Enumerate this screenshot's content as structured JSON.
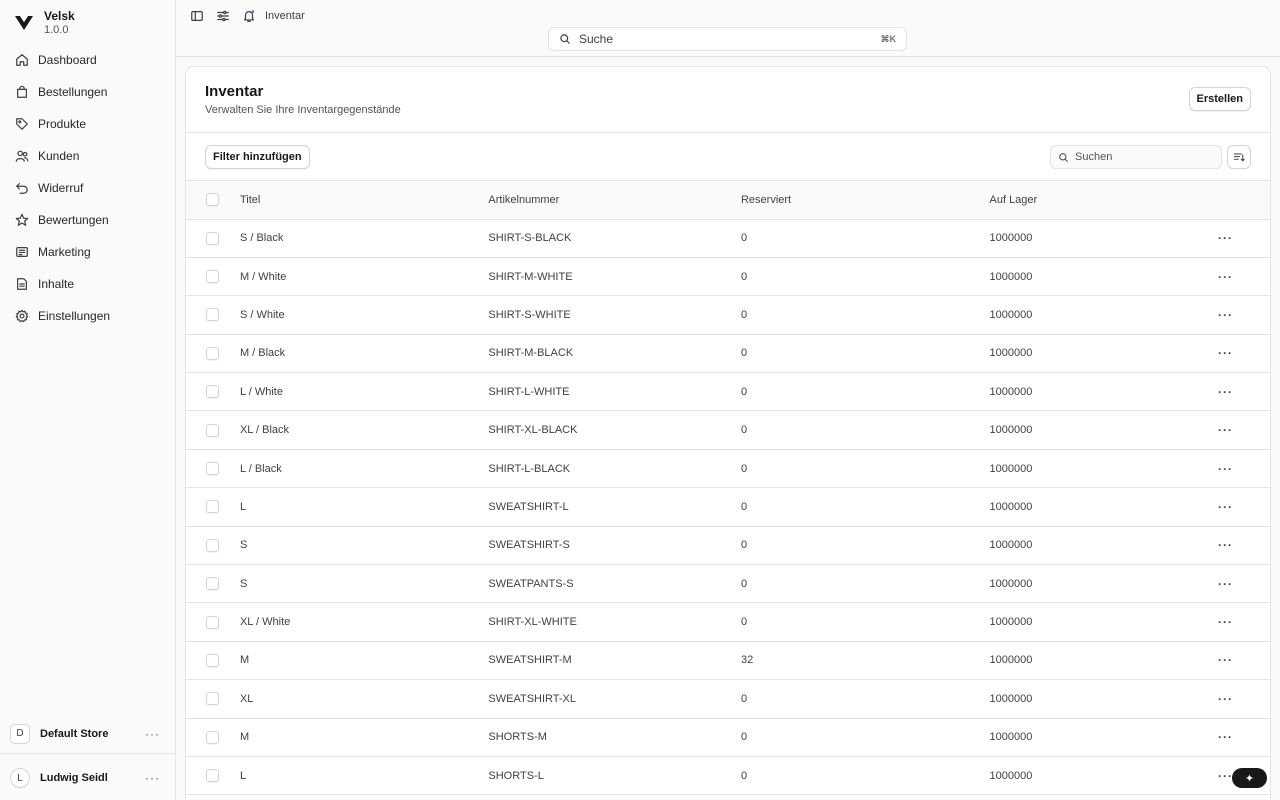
{
  "brand": {
    "name": "Velsk",
    "version": "1.0.0"
  },
  "nav": [
    {
      "label": "Dashboard",
      "icon": "home-icon"
    },
    {
      "label": "Bestellungen",
      "icon": "shopping-bag-icon"
    },
    {
      "label": "Produkte",
      "icon": "tag-icon"
    },
    {
      "label": "Kunden",
      "icon": "users-icon"
    },
    {
      "label": "Widerruf",
      "icon": "return-arrow-icon"
    },
    {
      "label": "Bewertungen",
      "icon": "star-icon"
    },
    {
      "label": "Marketing",
      "icon": "receipt-icon"
    },
    {
      "label": "Inhalte",
      "icon": "document-icon"
    },
    {
      "label": "Einstellungen",
      "icon": "gear-icon"
    }
  ],
  "store": {
    "initial": "D",
    "name": "Default Store",
    "more": "···"
  },
  "user": {
    "initial": "L",
    "name": "Ludwig Seidl",
    "more": "···"
  },
  "topbar": {
    "breadcrumb": "Inventar",
    "search_label": "Suche",
    "search_shortcut": "⌘K"
  },
  "page": {
    "title": "Inventar",
    "subtitle": "Verwalten Sie Ihre Inventargegenstände",
    "create_label": "Erstellen",
    "filter_label": "Filter hinzufügen",
    "search_placeholder": "Suchen"
  },
  "table": {
    "columns": [
      "Titel",
      "Artikelnummer",
      "Reserviert",
      "Auf Lager"
    ],
    "rows": [
      {
        "title": "S / Black",
        "sku": "SHIRT-S-BLACK",
        "reserved": "0",
        "stock": "1000000"
      },
      {
        "title": "M / White",
        "sku": "SHIRT-M-WHITE",
        "reserved": "0",
        "stock": "1000000"
      },
      {
        "title": "S / White",
        "sku": "SHIRT-S-WHITE",
        "reserved": "0",
        "stock": "1000000"
      },
      {
        "title": "M / Black",
        "sku": "SHIRT-M-BLACK",
        "reserved": "0",
        "stock": "1000000"
      },
      {
        "title": "L / White",
        "sku": "SHIRT-L-WHITE",
        "reserved": "0",
        "stock": "1000000"
      },
      {
        "title": "XL / Black",
        "sku": "SHIRT-XL-BLACK",
        "reserved": "0",
        "stock": "1000000"
      },
      {
        "title": "L / Black",
        "sku": "SHIRT-L-BLACK",
        "reserved": "0",
        "stock": "1000000"
      },
      {
        "title": "L",
        "sku": "SWEATSHIRT-L",
        "reserved": "0",
        "stock": "1000000"
      },
      {
        "title": "S",
        "sku": "SWEATSHIRT-S",
        "reserved": "0",
        "stock": "1000000"
      },
      {
        "title": "S",
        "sku": "SWEATPANTS-S",
        "reserved": "0",
        "stock": "1000000"
      },
      {
        "title": "XL / White",
        "sku": "SHIRT-XL-WHITE",
        "reserved": "0",
        "stock": "1000000"
      },
      {
        "title": "M",
        "sku": "SWEATSHIRT-M",
        "reserved": "32",
        "stock": "1000000"
      },
      {
        "title": "XL",
        "sku": "SWEATSHIRT-XL",
        "reserved": "0",
        "stock": "1000000"
      },
      {
        "title": "M",
        "sku": "SHORTS-M",
        "reserved": "0",
        "stock": "1000000"
      },
      {
        "title": "L",
        "sku": "SHORTS-L",
        "reserved": "0",
        "stock": "1000000"
      }
    ],
    "row_action": "···"
  },
  "fab": {
    "symbol": "✦"
  }
}
